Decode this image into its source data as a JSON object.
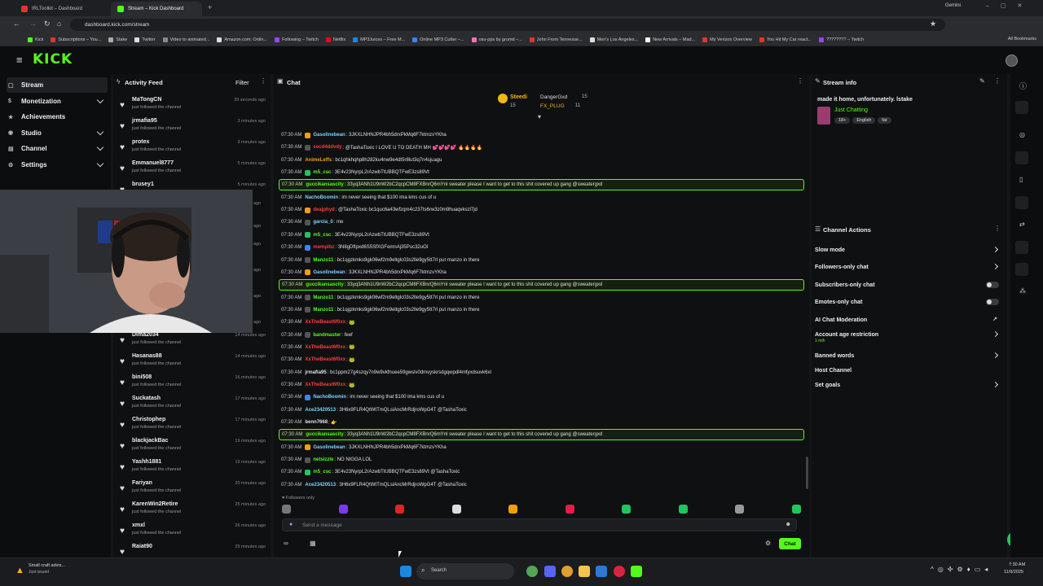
{
  "browser": {
    "tabs": [
      {
        "label": "IRLToolkit – Dashboard",
        "color": "#e0352b"
      },
      {
        "label": "Stream – Kick Dashboard",
        "color": "#53fc18"
      }
    ],
    "url": "dashboard.kick.com/stream",
    "gemini": "Gemini",
    "bookmarks": [
      "Kick",
      "Subscriptions – You...",
      "Stake",
      "Twitter",
      "Video to animated...",
      "Amazon.com: Onlin...",
      "Following – Twitch",
      "Netflix",
      "MP3Juices – Free M...",
      "Online MP3 Cutter –...",
      "osu-pps by grumd –...",
      "John From Tennesse...",
      "Men's Los Angeles...",
      "New Arrivals – Mad...",
      "My Verizon Overview",
      "You Hit My Car react...",
      "???????? – Twitch"
    ],
    "all_bookmarks": "All Bookmarks"
  },
  "app": {
    "logo": "KICK",
    "accent": "#53fc18"
  },
  "sidebar": {
    "items": [
      {
        "label": "Stream",
        "has_chevron": false
      },
      {
        "label": "Monetization",
        "has_chevron": true
      },
      {
        "label": "Achievements",
        "has_chevron": false
      },
      {
        "label": "Studio",
        "has_chevron": true
      },
      {
        "label": "Channel",
        "has_chevron": true
      },
      {
        "label": "Settings",
        "has_chevron": true
      }
    ]
  },
  "activity": {
    "title": "Activity Feed",
    "filter": "Filter",
    "items": [
      {
        "name": "MaTongCN",
        "sub": "just followed the channel",
        "time": "39 seconds ago"
      },
      {
        "name": "jrmafia95",
        "sub": "just followed the channel",
        "time": "3 minutes ago"
      },
      {
        "name": "protex",
        "sub": "just followed the channel",
        "time": "3 minutes ago"
      },
      {
        "name": "Emmanuel8777",
        "sub": "just followed the channel",
        "time": "5 minutes ago"
      },
      {
        "name": "brusey1",
        "sub": "",
        "time": "5 minutes ago"
      },
      {
        "name": "Dima2034",
        "sub": "just followed the channel",
        "time": "14 minutes ago"
      },
      {
        "name": "Hasanas88",
        "sub": "just followed the channel",
        "time": "14 minutes ago"
      },
      {
        "name": "bini508",
        "sub": "just followed the channel",
        "time": "16 minutes ago"
      },
      {
        "name": "Suckatash",
        "sub": "just followed the channel",
        "time": "17 minutes ago"
      },
      {
        "name": "Christophep",
        "sub": "just followed the channel",
        "time": "17 minutes ago"
      },
      {
        "name": "blackjackBac",
        "sub": "just followed the channel",
        "time": "19 minutes ago"
      },
      {
        "name": "Yashh1881",
        "sub": "just followed the channel",
        "time": "19 minutes ago"
      },
      {
        "name": "Fariyan",
        "sub": "just followed the channel",
        "time": "20 minutes ago"
      },
      {
        "name": "KarenWin2Retire",
        "sub": "just followed the channel",
        "time": "25 minutes ago"
      },
      {
        "name": "xmxl",
        "sub": "just followed the channel",
        "time": "26 minutes ago"
      },
      {
        "name": "Raiat90",
        "sub": "",
        "time": "29 minutes ago"
      }
    ],
    "partial_times": [
      "ago",
      "ago",
      "ago",
      "ago",
      "ago",
      "ago"
    ]
  },
  "chat": {
    "title": "Chat",
    "pinned": {
      "user1": "Steedi",
      "count1": "15",
      "user2": "DangerGxd",
      "count2": "15",
      "user3": "FX_PLUG",
      "count3": "11"
    },
    "messages": [
      {
        "time": "07:30 AM",
        "user": "Gasolinebean",
        "text": ": 3JKXLNHNJPR4bh5drxPkMq6F7ktmzvYKha",
        "color": "#7dd3fc",
        "badge": "#f59e0b",
        "hl": false
      },
      {
        "time": "07:30 AM",
        "user": "socd4ddvdy",
        "text": ": @TashaToxic I LOVE U TO DEATH MH 💕💕💕💕 🔥🔥🔥🔥",
        "color": "#ff3b3b",
        "badge": "#555",
        "hl": false
      },
      {
        "time": "07:30 AM",
        "user": "AnimeLeffs",
        "text": ": bc1qhkhqhp8h282ku4nw9e4dt5r8lut3q7n4sjuagu",
        "color": "#f59e0b",
        "badge": "",
        "hl": false
      },
      {
        "time": "07:30 AM",
        "user": "m5_csc",
        "text": ": 3E4v23NyrpL2rAzwbTtUBBQTFwE3zs89Vt",
        "color": "#53fc18",
        "badge": "#22c55e",
        "hl": false
      },
      {
        "time": "07:30 AM",
        "user": "guccikansascity",
        "text": ": 33yq3ANh1U9nW2bC2qcpCM8FXBnrQ6mYnl sweater please I want to get to this shit covered up gang @sweatergxd",
        "color": "#53fc18",
        "badge": "",
        "hl": true
      },
      {
        "time": "07:30 AM",
        "user": "NachoBoomin",
        "text": ": im never seeing that $100 ima kms cus of u",
        "color": "#7dd3fc",
        "badge": "",
        "hl": false
      },
      {
        "time": "07:30 AM",
        "user": "deajphyd",
        "text": ": @TashaToxic bc1quc6a43wfzqm4c237ts6rw3z0m9huaqvkszl7jd",
        "color": "#ff3b3b",
        "badge": "#f59e0b",
        "hl": false
      },
      {
        "time": "07:30 AM",
        "user": "garcia_0",
        "text": ": me",
        "color": "#7dd3fc",
        "badge": "#555",
        "hl": false
      },
      {
        "time": "07:30 AM",
        "user": "m5_csc",
        "text": ": 3E4v23NyrpL2rAzwbTtUBBQTFwE3zs89Vt",
        "color": "#53fc18",
        "badge": "#22c55e",
        "hl": false
      },
      {
        "time": "07:30 AM",
        "user": "memplbz",
        "text": ": 3N8gDftpxd6S5SfXGFemnAj35Puc32uOl",
        "color": "#ff3b3b",
        "badge": "#3b82f6",
        "hl": false
      },
      {
        "time": "07:30 AM",
        "user": "Manzo11",
        "text": ": bc1qgzkmks9gk06wf2m9eltglc03s2lle9gy5tt7rl put manzo in there",
        "color": "#53fc18",
        "badge": "#555",
        "hl": false
      },
      {
        "time": "07:30 AM",
        "user": "Gasolinebean",
        "text": ": 3JKXLNHNJPR4bh5drxPkMq6F7ktmzvYKha",
        "color": "#7dd3fc",
        "badge": "#f59e0b",
        "hl": false
      },
      {
        "time": "07:30 AM",
        "user": "guccikansascity",
        "text": ": 33yq3ANh1U9nW2bC2qcpCM8FXBnrQ6mYnl sweater please I want to get to this shit covered up gang @sweatergxd",
        "color": "#53fc18",
        "badge": "",
        "hl": true
      },
      {
        "time": "07:30 AM",
        "user": "Manzo11",
        "text": ": bc1qgzkmks9gk06wf2m9eltglc03s2lle9gy5tt7rl put manzo in there",
        "color": "#53fc18",
        "badge": "#555",
        "hl": false
      },
      {
        "time": "07:30 AM",
        "user": "Manzo11",
        "text": ": bc1qgzkmks9gk06wf2m9eltglc03s2lle9gy5tt7rl put manzo in there",
        "color": "#53fc18",
        "badge": "#555",
        "hl": false
      },
      {
        "time": "07:30 AM",
        "user": "XxTheBeast6f0xx",
        "text": ": 🐸",
        "color": "#ff3b3b",
        "badge": "",
        "hl": false
      },
      {
        "time": "07:30 AM",
        "user": "bandmaster",
        "text": ": feef",
        "color": "#53fc18",
        "badge": "#555",
        "hl": false
      },
      {
        "time": "07:30 AM",
        "user": "XxTheBeast6f0xx",
        "text": ": 🐸",
        "color": "#ff3b3b",
        "badge": "",
        "hl": false
      },
      {
        "time": "07:30 AM",
        "user": "XxTheBeast6f0xx",
        "text": ": 🐸",
        "color": "#ff3b3b",
        "badge": "",
        "hl": false
      },
      {
        "time": "07:30 AM",
        "user": "jrmafia95",
        "text": ": bc1ppm27g4szqy7n9w9vkfnuee59gwslv0dmvyskrsdgqwpdl4mfyxdsuvk6xl",
        "color": "#e0e0e0",
        "badge": "",
        "hl": false
      },
      {
        "time": "07:30 AM",
        "user": "XxTheBeast6f0xx",
        "text": ": 🐸",
        "color": "#ff3b3b",
        "badge": "",
        "hl": false
      },
      {
        "time": "07:30 AM",
        "user": "NachoBoomin",
        "text": ": im never seeing that $100 ima kms cus of u",
        "color": "#7dd3fc",
        "badge": "#3b82f6",
        "hl": false
      },
      {
        "time": "07:30 AM",
        "user": "Ace23420513",
        "text": ": 3H6x9FLR4QtWtTmQLsiAncMrRdjroWpG4T @TashaToxic",
        "color": "#7dd3fc",
        "badge": "",
        "hl": false
      },
      {
        "time": "07:30 AM",
        "user": "benn7668",
        "text": ": 👉",
        "color": "#e0e0e0",
        "badge": "",
        "hl": false
      },
      {
        "time": "07:30 AM",
        "user": "guccikansascity",
        "text": ": 33yq3ANh1U9nW2bC2qcpCM8FXBnrQ6mYnl sweater please I want to get to this shit covered up gang @sweatergxd",
        "color": "#53fc18",
        "badge": "",
        "hl": true
      },
      {
        "time": "07:30 AM",
        "user": "Gasolinebean",
        "text": ": 3JKXLNHNJPR4bh5drxPkMq6F7ktmzvYKha",
        "color": "#7dd3fc",
        "badge": "#f59e0b",
        "hl": false
      },
      {
        "time": "07:30 AM",
        "user": "netsizzle",
        "text": ": NO NIGGA LOL",
        "color": "#53fc18",
        "badge": "#555",
        "hl": false
      },
      {
        "time": "07:30 AM",
        "user": "m5_csc",
        "text": ": 3E4v23NyrpL2rAzwbTtUBBQTFwE3zs89Vt @TashaToxic",
        "color": "#53fc18",
        "badge": "#22c55e",
        "hl": false
      },
      {
        "time": "07:30 AM",
        "user": "Ace23420513",
        "text": ": 3H6x9FLR4QtWtTmQLsiAncMrRdjroWpG4T @TashaToxic",
        "color": "#7dd3fc",
        "badge": "",
        "hl": false
      }
    ],
    "followers_only": "Followers only",
    "placeholder": "Send a message",
    "send": "Chat"
  },
  "stream_info": {
    "title": "Stream info",
    "stream_title": "made it home, unfortunately. lstake",
    "category": "Just Chatting",
    "tags": [
      "18+",
      "English",
      "fat"
    ]
  },
  "channel_actions": {
    "title": "Channel Actions",
    "items": [
      {
        "label": "Slow mode",
        "control": "arrow"
      },
      {
        "label": "Followers-only chat",
        "control": "arrow"
      },
      {
        "label": "Subscribers-only chat",
        "control": "toggle"
      },
      {
        "label": "Emotes-only chat",
        "control": "toggle"
      },
      {
        "label": "AI Chat Moderation",
        "control": "external"
      },
      {
        "label": "Account age restriction",
        "control": "arrow",
        "sub": "1 mth"
      },
      {
        "label": "Banned words",
        "control": "arrow"
      },
      {
        "label": "Host Channel",
        "control": "none"
      },
      {
        "label": "Set goals",
        "control": "arrow"
      }
    ]
  },
  "taskbar": {
    "weather": "Small craft advis...",
    "weather_sub": "Just issued",
    "search": "Search",
    "time": "7:30 AM",
    "date": "11/9/2025"
  }
}
